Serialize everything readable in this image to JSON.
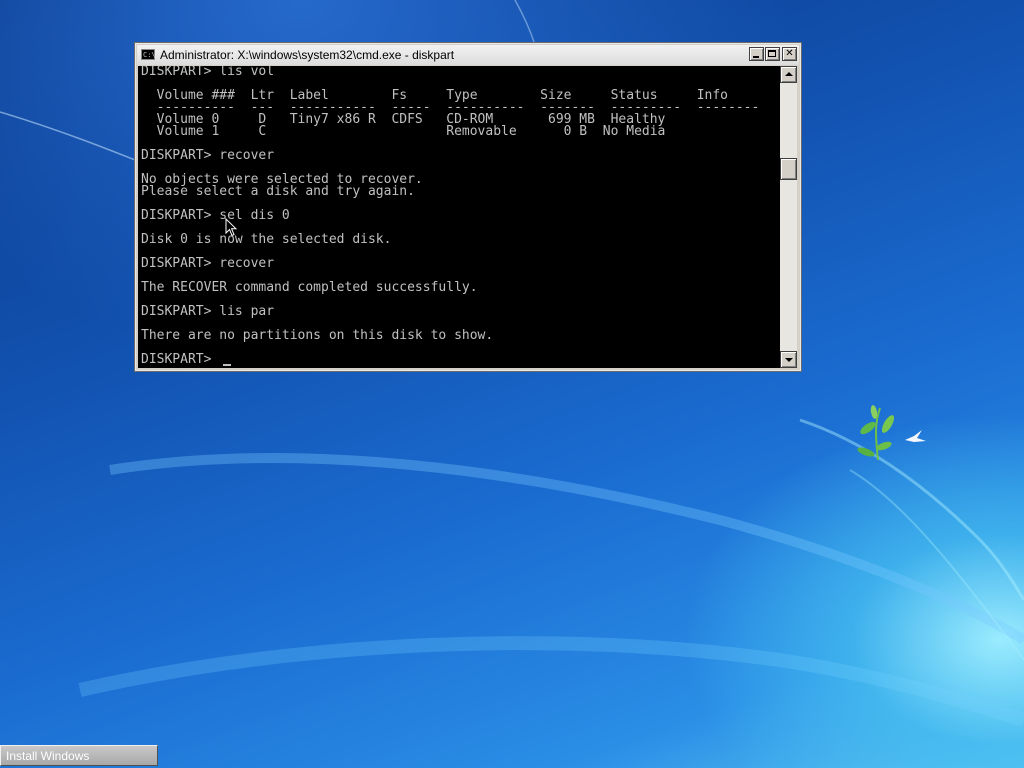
{
  "window": {
    "title": "Administrator: X:\\windows\\system32\\cmd.exe - diskpart",
    "icon": "cmd-console-icon",
    "icon_text": "C:\\"
  },
  "console": {
    "text": "DISKPART> lis vol\n\n  Volume ###  Ltr  Label        Fs     Type        Size     Status     Info\n  ----------  ---  -----------  -----  ----------  -------  ---------  --------\n  Volume 0     D   Tiny7 x86 R  CDFS   CD-ROM       699 MB  Healthy\n  Volume 1     C                       Removable      0 B  No Media\n\nDISKPART> recover\n\nNo objects were selected to recover.\nPlease select a disk and try again.\n\nDISKPART> sel dis 0\n\nDisk 0 is now the selected disk.\n\nDISKPART> recover\n\nThe RECOVER command completed successfully.\n\nDISKPART> lis par\n\nThere are no partitions on this disk to show.\n\nDISKPART> "
  },
  "taskbar": {
    "button_label": "Install Windows"
  },
  "colors": {
    "console_bg": "#000000",
    "console_fg": "#c0c0c0",
    "desktop_blue": "#1a6bd0"
  }
}
